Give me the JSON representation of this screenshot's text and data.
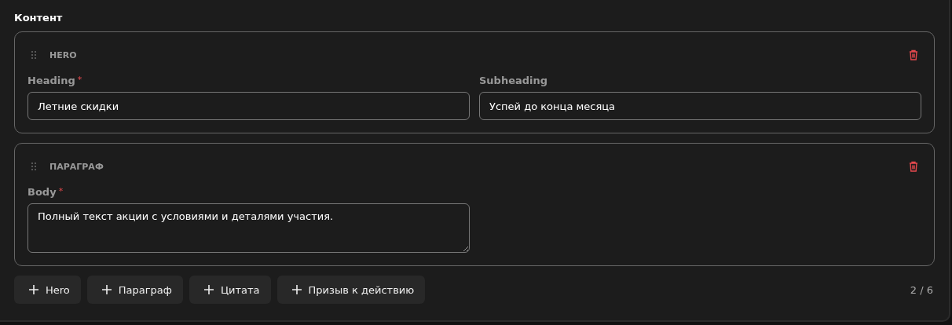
{
  "section_title": "Контент",
  "blocks": [
    {
      "type_label": "HERO",
      "fields": [
        {
          "label": "Heading",
          "required": true,
          "kind": "input",
          "value": "Летние скидки"
        },
        {
          "label": "Subheading",
          "required": false,
          "kind": "input",
          "value": "Успей до конца месяца"
        }
      ]
    },
    {
      "type_label": "ПАРАГРАФ",
      "fields": [
        {
          "label": "Body",
          "required": true,
          "kind": "textarea",
          "value": "Полный текст акции с условиями и деталями участия."
        }
      ]
    }
  ],
  "add_buttons": [
    "Hero",
    "Параграф",
    "Цитата",
    "Призыв к действию"
  ],
  "counter": "2 / 6",
  "required_mark": "*"
}
